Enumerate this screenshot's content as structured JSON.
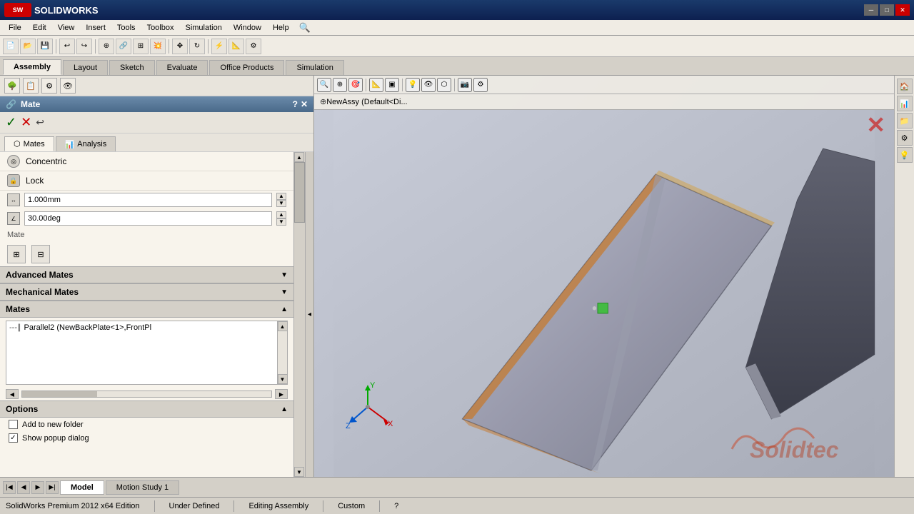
{
  "titlebar": {
    "logo": "SW",
    "app_name": "SOLIDWORKS",
    "title": "SOLIDWORKS Premium 2012 x64 Edition",
    "win_minimize": "─",
    "win_restore": "□",
    "win_close": "✕"
  },
  "menubar": {
    "items": [
      "File",
      "Edit",
      "View",
      "Insert",
      "Tools",
      "Toolbox",
      "Simulation",
      "Window",
      "Help"
    ]
  },
  "tabbar": {
    "tabs": [
      "Assembly",
      "Layout",
      "Sketch",
      "Evaluate",
      "Office Products",
      "Simulation"
    ]
  },
  "panel": {
    "title": "Mate",
    "close_btn": "✕",
    "help_btn": "?",
    "actions": {
      "confirm": "✓",
      "cancel": "✕",
      "back": "↩"
    },
    "sub_tabs": [
      "Mates",
      "Analysis"
    ],
    "mate_types": [
      {
        "label": "Concentric",
        "icon": "◎"
      },
      {
        "label": "Lock",
        "icon": "🔒"
      }
    ],
    "inputs": [
      {
        "value": "1.000mm",
        "icon": "↔"
      },
      {
        "value": "30.00deg",
        "icon": "∠"
      }
    ],
    "mate_label": "Mate",
    "grid_icons": [
      "⊞",
      "⊟"
    ],
    "sections": {
      "advanced_mates": "Advanced Mates",
      "mechanical_mates": "Mechanical Mates",
      "mates": "Mates"
    },
    "mates_list": [
      {
        "label": "Parallel2 (NewBackPlate<1>,FrontPl",
        "icon": "∥"
      }
    ],
    "options": {
      "title": "Options",
      "items": [
        {
          "label": "Add to new folder",
          "checked": false
        },
        {
          "label": "Show popup dialog",
          "checked": true
        }
      ]
    }
  },
  "viewport": {
    "tree_path": "NewAssy (Default<Di...",
    "toolbar_icons": [
      "🔍+",
      "🔍-",
      "🎯",
      "📐",
      "🔲",
      "◉",
      "💡",
      "⬡",
      "👁",
      "⚙"
    ],
    "right_icons": [
      "🏠",
      "📊",
      "📁",
      "⚙",
      "💡"
    ]
  },
  "bottom_tabs": {
    "nav_prev": "◀",
    "nav_next": "▶",
    "nav_start": "|◀",
    "nav_end": "▶|",
    "tabs": [
      "Model",
      "Motion Study 1"
    ],
    "active": "Model"
  },
  "statusbar": {
    "app_name": "SolidWorks Premium 2012 x64 Edition",
    "status1": "Under Defined",
    "status2": "Editing Assembly",
    "status3": "Custom",
    "help": "?"
  },
  "icons": {
    "chevron_down": "▼",
    "chevron_right": "►",
    "collapse": "◂",
    "expand": "▸",
    "settings": "⚙",
    "search": "🔍"
  }
}
